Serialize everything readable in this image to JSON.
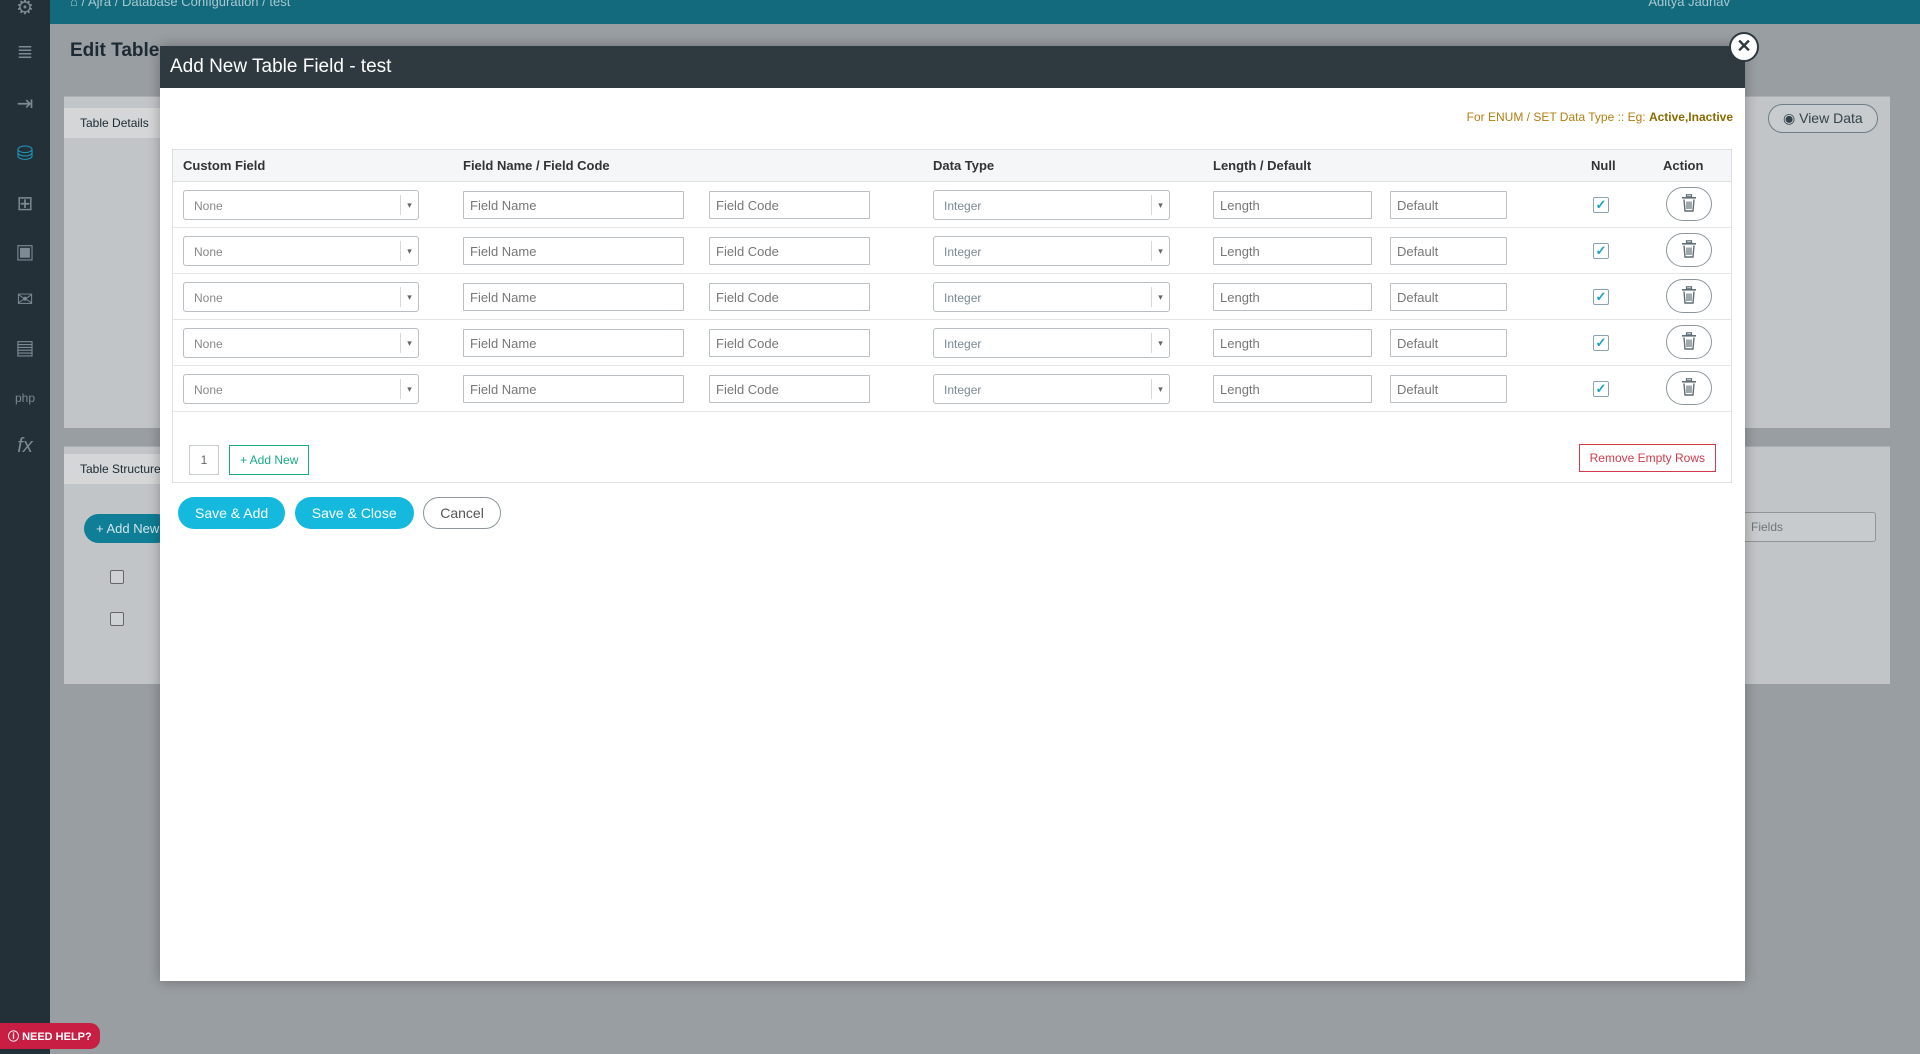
{
  "background": {
    "breadcrumb": [
      "Ajra",
      "Database Configuration",
      "test"
    ],
    "user_name": "Aditya Jadhav",
    "page_title": "Edit Table",
    "tab_table_details": "Table Details",
    "tab_table_structure": "Table Structure",
    "view_data": "View Data",
    "add_new": "+ Add New",
    "fields_select": "Fields"
  },
  "help_label": "NEED HELP?",
  "modal": {
    "title": "Add New Table Field - test",
    "close_glyph": "✕",
    "hint_prefix": "For ENUM / SET Data Type :: Eg: ",
    "hint_example": "Active,Inactive",
    "columns": {
      "custom_field": "Custom Field",
      "field_name_code": "Field Name / Field Code",
      "data_type": "Data Type",
      "length_default": "Length / Default",
      "null": "Null",
      "action": "Action"
    },
    "placeholders": {
      "field_name": "Field Name",
      "field_code": "Field Code",
      "length": "Length",
      "default": "Default"
    },
    "rows": [
      {
        "custom_field": "None",
        "data_type": "Integer",
        "null_checked": true
      },
      {
        "custom_field": "None",
        "data_type": "Integer",
        "null_checked": true
      },
      {
        "custom_field": "None",
        "data_type": "Integer",
        "null_checked": true
      },
      {
        "custom_field": "None",
        "data_type": "Integer",
        "null_checked": true
      },
      {
        "custom_field": "None",
        "data_type": "Integer",
        "null_checked": true
      }
    ],
    "page_number": "1",
    "add_new_label": "+ Add New",
    "remove_empty_label": "Remove Empty Rows",
    "save_add_label": "Save & Add",
    "save_close_label": "Save & Close",
    "cancel_label": "Cancel"
  },
  "colors": {
    "modal_header": "#2e3a40",
    "primary": "#15b9dd",
    "add_new": "#1aaa85",
    "remove": "#d23b4c",
    "hint": "#b37d10"
  }
}
